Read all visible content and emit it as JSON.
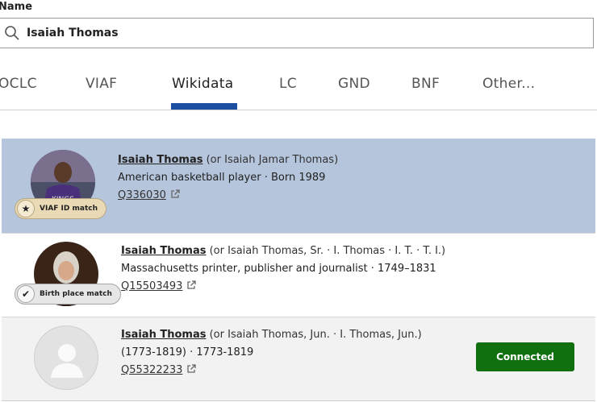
{
  "search": {
    "label": "Name",
    "value": "Isaiah Thomas"
  },
  "tabs": [
    {
      "label": "OCLC"
    },
    {
      "label": "VIAF"
    },
    {
      "label": "Wikidata",
      "active": true
    },
    {
      "label": "LC"
    },
    {
      "label": "GND"
    },
    {
      "label": "BNF"
    },
    {
      "label": "Other..."
    }
  ],
  "results": [
    {
      "name": "Isaiah Thomas",
      "alt": " (or Isaiah Jamar Thomas)",
      "description": "American basketball player · Born 1989",
      "qid": "Q336030",
      "badge": "VIAF ID match",
      "selected": true
    },
    {
      "name": "Isaiah Thomas",
      "alt": " (or Isaiah Thomas, Sr. · I. Thomas · I. T. · T. I.)",
      "description": "Massachusetts printer, publisher and journalist · 1749–1831",
      "qid": "Q15503493",
      "badge": "Birth place match"
    },
    {
      "name": "Isaiah Thomas",
      "alt": " (or Isaiah Thomas, Jun. · I. Thomas, Jun.)",
      "description": "(1773-1819) · 1773-1819",
      "qid": "Q55322233",
      "status_button": "Connected"
    }
  ],
  "colors": {
    "tab_underline": "#1c4fa0",
    "selected_row": "#b5c5dc",
    "connected_button": "#107010"
  }
}
